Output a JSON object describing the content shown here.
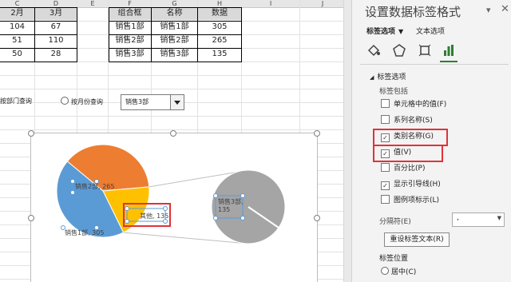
{
  "columns": [
    "C",
    "D",
    "E",
    "F",
    "G",
    "H",
    "I",
    "J"
  ],
  "table1": {
    "headers": [
      "2月",
      "3月"
    ],
    "rows": [
      [
        "104",
        "67"
      ],
      [
        "51",
        "110"
      ],
      [
        "50",
        "28"
      ]
    ]
  },
  "table2": {
    "headers": [
      "组合框",
      "名称",
      "数据"
    ],
    "rows": [
      [
        "销售1部",
        "销售1部",
        "305"
      ],
      [
        "销售2部",
        "销售2部",
        "265"
      ],
      [
        "销售3部",
        "销售3部",
        "135"
      ]
    ]
  },
  "controls": {
    "dept": "按部门查询",
    "month": "按月份查询",
    "combo": "销售3部"
  },
  "chart_data": {
    "type": "pie",
    "main_slices": [
      {
        "name": "销售2部",
        "value": 265,
        "color": "#ed7d31",
        "label": "销售2部, 265"
      },
      {
        "name": "其他",
        "value": 135,
        "color": "#ffc000",
        "label": "其他, 135"
      },
      {
        "name": "销售1部",
        "value": 305,
        "color": "#5b9bd5",
        "label": "销售1部, 305"
      }
    ],
    "sub_slice": {
      "name": "销售3部",
      "value": 135,
      "color": "#a5a5a5",
      "label": "销售3部,\n135"
    }
  },
  "panel": {
    "title": "设置数据标签格式",
    "tab_label": "标签选项",
    "tab_text": "文本选项",
    "section": "标签选项",
    "includes": "标签包括",
    "checkboxes": [
      {
        "label": "单元格中的值(F)",
        "checked": false
      },
      {
        "label": "系列名称(S)",
        "checked": false
      },
      {
        "label": "类别名称(G)",
        "checked": true
      },
      {
        "label": "值(V)",
        "checked": true
      },
      {
        "label": "百分比(P)",
        "checked": false
      },
      {
        "label": "显示引导线(H)",
        "checked": true
      },
      {
        "label": "图例项标示(L)",
        "checked": false
      }
    ],
    "separator_label": "分隔符(E)",
    "separator_value": ",",
    "reset_button": "重设标签文本(R)",
    "position_label": "标签位置",
    "position_center": "居中(C)"
  }
}
